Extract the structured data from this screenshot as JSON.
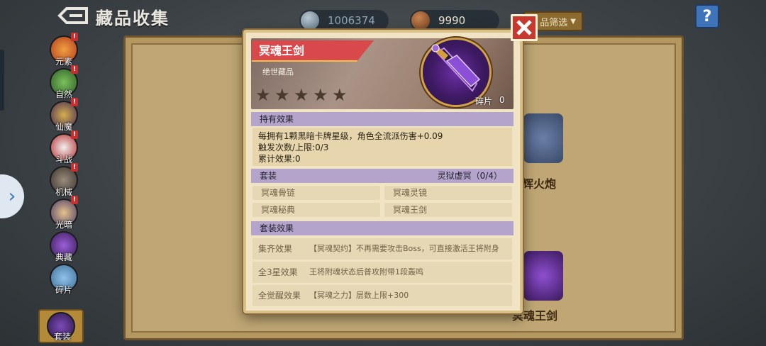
{
  "header": {
    "title": "藏品收集",
    "currency_silver": "1006374",
    "currency_copper": "9990",
    "filter_label": "品筛选",
    "help_label": "?"
  },
  "sidebar": {
    "expand_label": "›",
    "categories": [
      {
        "label": "元素",
        "badge": "!"
      },
      {
        "label": "自然",
        "badge": "!"
      },
      {
        "label": "仙魔",
        "badge": "!"
      },
      {
        "label": "斗战",
        "badge": "!"
      },
      {
        "label": "机械",
        "badge": "!"
      },
      {
        "label": "光暗",
        "badge": "!"
      },
      {
        "label": "典藏",
        "badge": ""
      },
      {
        "label": "碎片",
        "badge": ""
      },
      {
        "label": "套装",
        "badge": ""
      }
    ]
  },
  "background_items": {
    "item_right": "辉火炮",
    "item_bottom_right": "冥魂王剑"
  },
  "modal": {
    "name": "冥魂王剑",
    "rarity": "绝世藏品",
    "stars_filled": 5,
    "stars_total": 5,
    "fragment_label": "碎片",
    "fragment_count": "0",
    "hold_effect_title": "持有效果",
    "hold_effect_lines": [
      "每拥有1颗黑暗卡牌星级，角色全流派伤害+0.09",
      "触发次数/上限:0/3",
      "累计效果:0"
    ],
    "set_title": "套装",
    "set_name": "灵狱虚冥（0/4）",
    "set_pieces": [
      "冥魂骨链",
      "冥魂灵镜",
      "冥魂秘典",
      "冥魂王剑"
    ],
    "set_effect_title": "套装效果",
    "set_effects": [
      {
        "key": "集齐效果",
        "value": "【冥魂契约】不再需要攻击Boss，可直接激活王将附身"
      },
      {
        "key": "全3星效果",
        "value": "王将附魂状态后普攻附带1段轰鸣"
      },
      {
        "key": "全觉醒效果",
        "value": "【冥魂之力】层数上限+300"
      }
    ]
  },
  "colors": {
    "banner_red": "#d9494b",
    "section_purple": "#b4a4cc",
    "close_red": "#c8382e",
    "panel_gold": "#b59760"
  }
}
